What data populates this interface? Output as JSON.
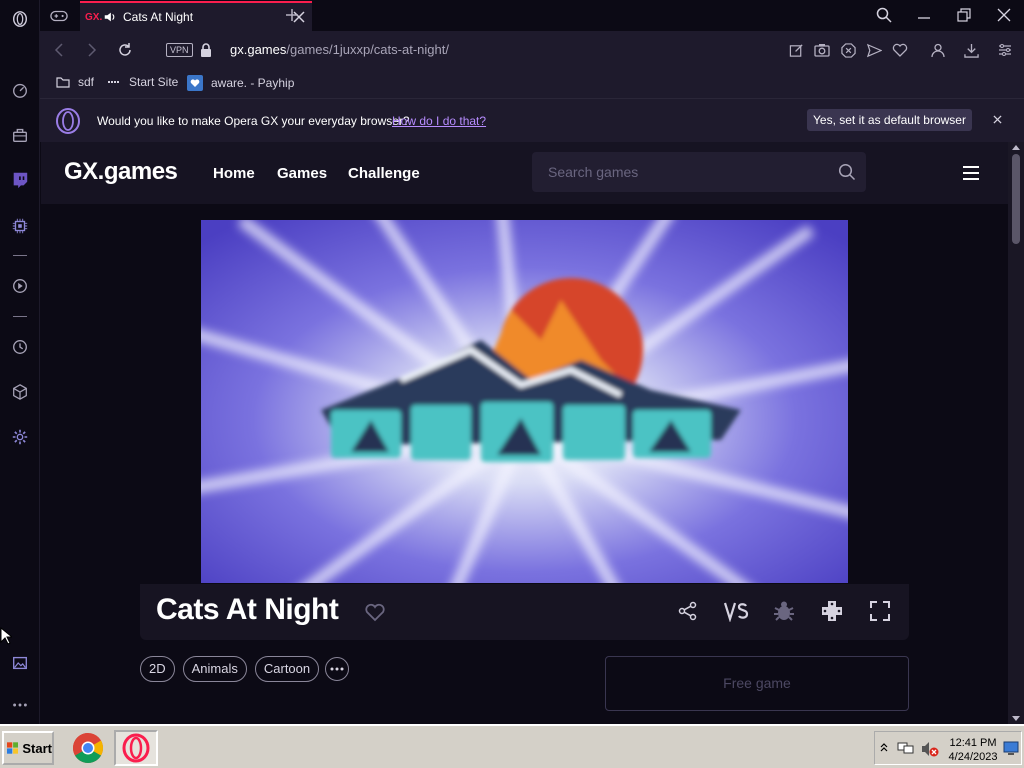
{
  "browser": {
    "tab": {
      "badge": "GX.",
      "title": "Cats At Night"
    },
    "address": {
      "vpn_label": "VPN",
      "url_host": "gx.games",
      "url_path": "/games/1juxxp/cats-at-night/"
    },
    "bookmarks": [
      {
        "label": "sdf",
        "icon": "folder-icon"
      },
      {
        "label": "Start Site",
        "icon": "dash-icon"
      },
      {
        "label": "aware. - Payhip",
        "icon": "heart-badge-icon"
      }
    ],
    "infobar": {
      "message": "Would you like to make Opera GX your everyday browser?",
      "link": "How do I do that?",
      "button": "Yes, set it as default browser"
    }
  },
  "site": {
    "logo": "GX.games",
    "nav": [
      "Home",
      "Games",
      "Challenge"
    ],
    "search_placeholder": "Search games"
  },
  "game": {
    "title": "Cats At Night",
    "tags": [
      "2D",
      "Animals",
      "Cartoon"
    ],
    "cta": "Free game"
  },
  "taskbar": {
    "start_label": "Start",
    "time": "12:41 PM",
    "date": "4/24/2023"
  },
  "colors": {
    "accent": "#fa1e4e",
    "page_bg": "#0c0a15",
    "chrome_bg": "#1e1a2c",
    "link": "#b78cff"
  }
}
